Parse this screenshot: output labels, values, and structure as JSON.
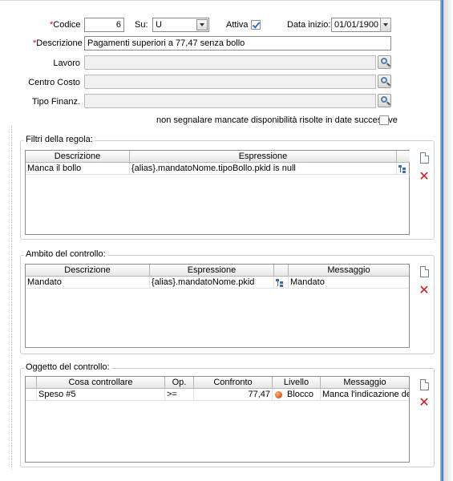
{
  "header": {
    "codice_label": "Codice",
    "codice_value": "6",
    "su_label": "Su:",
    "su_value": "U",
    "attiva_label": "Attiva",
    "attiva_checked": true,
    "data_inizio_label": "Data inizio:",
    "data_inizio_value": "01/01/1900",
    "descrizione_label": "Descrizione",
    "descrizione_value": "Pagamenti superiori a 77,47 senza bollo",
    "lavoro_label": "Lavoro",
    "centro_costo_label": "Centro Costo",
    "tipo_finanz_label": "Tipo Finanz.",
    "non_segnalare_label": "non segnalare mancate disponibilità risolte in date successive",
    "non_segnalare_checked": false,
    "required_marker": "*"
  },
  "filtri": {
    "title": "Filtri della regola:",
    "columns": [
      "Descrizione",
      "Espressione"
    ],
    "rows": [
      {
        "descrizione": "Manca il bollo",
        "espressione": "{alias}.mandatoNome.tipoBollo.pkid is null"
      }
    ]
  },
  "ambito": {
    "title": "Ambito del controllo:",
    "columns": [
      "Descrizione",
      "Espressione",
      "",
      "Messaggio"
    ],
    "rows": [
      {
        "descrizione": "Mandato",
        "espressione": "{alias}.mandatoNome.pkid",
        "messaggio": "Mandato"
      }
    ]
  },
  "oggetto": {
    "title": "Oggetto del controllo:",
    "columns": [
      "Cosa controllare",
      "Op.",
      "Confronto",
      "Livello",
      "Messaggio"
    ],
    "rows": [
      {
        "cosa": "Speso #5",
        "op": ">=",
        "confronto": "77,47",
        "livello": "Blocco",
        "messaggio": "Manca l'indicazione del bollo"
      }
    ]
  },
  "icons": {
    "lookup": "magnifier-icon",
    "new": "new-document-icon",
    "delete": "delete-x-icon",
    "tree": "expression-tree-icon",
    "level": "red-dot-icon"
  },
  "colors": {
    "required": "#e0001a",
    "delete": "#d4161a",
    "edge_accent": "#5b8fd6"
  }
}
